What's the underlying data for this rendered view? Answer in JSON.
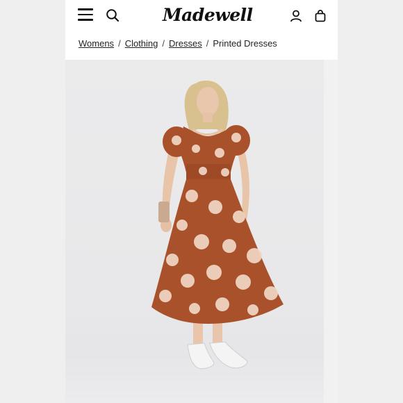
{
  "header": {
    "brand": "Madewell",
    "icons": {
      "menu": "menu-icon",
      "search": "search-icon",
      "account": "account-icon",
      "bag": "shopping-bag-icon"
    }
  },
  "breadcrumb": {
    "items": [
      {
        "label": "Womens"
      },
      {
        "label": "Clothing"
      },
      {
        "label": "Dresses"
      }
    ],
    "separator": "/",
    "current": "Printed Dresses"
  },
  "product_image": {
    "colors": {
      "dress": "#a9512b",
      "flower": "#f1d7c6",
      "background": "#ebebec"
    }
  }
}
